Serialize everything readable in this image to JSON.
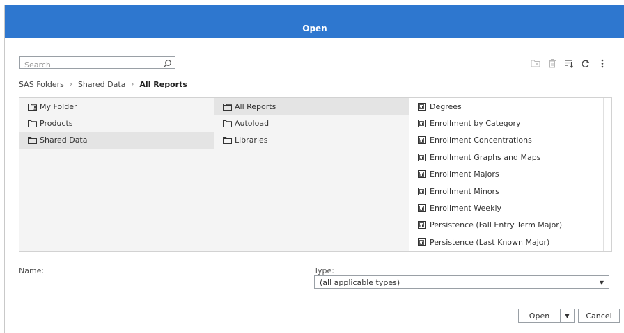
{
  "dialog": {
    "title": "Open"
  },
  "search": {
    "placeholder": "Search"
  },
  "toolbar": {
    "icons": [
      "new-folder-icon",
      "delete-icon",
      "sort-icon",
      "refresh-icon",
      "more-icon"
    ]
  },
  "breadcrumb": {
    "items": [
      "SAS Folders",
      "Shared Data"
    ],
    "current": "All Reports"
  },
  "columns": {
    "first": [
      {
        "label": "My Folder",
        "icon": "user-folder-icon"
      },
      {
        "label": "Products",
        "icon": "folder-icon"
      },
      {
        "label": "Shared Data",
        "icon": "folder-icon",
        "selected": true
      }
    ],
    "second": [
      {
        "label": "All Reports",
        "icon": "folder-icon",
        "selected": true
      },
      {
        "label": "Autoload",
        "icon": "folder-icon"
      },
      {
        "label": "Libraries",
        "icon": "folder-icon"
      }
    ],
    "third": [
      {
        "label": "Degrees",
        "icon": "report-icon"
      },
      {
        "label": "Enrollment by Category",
        "icon": "report-icon"
      },
      {
        "label": "Enrollment Concentrations",
        "icon": "report-icon"
      },
      {
        "label": "Enrollment Graphs and Maps",
        "icon": "report-icon"
      },
      {
        "label": "Enrollment Majors",
        "icon": "report-icon"
      },
      {
        "label": "Enrollment Minors",
        "icon": "report-icon"
      },
      {
        "label": "Enrollment Weekly",
        "icon": "report-icon"
      },
      {
        "label": "Persistence (Fall Entry Term Major)",
        "icon": "report-icon"
      },
      {
        "label": "Persistence (Last Known Major)",
        "icon": "report-icon"
      }
    ]
  },
  "form": {
    "name_label": "Name:",
    "type_label": "Type:",
    "type_value": "(all applicable types)"
  },
  "buttons": {
    "open": "Open",
    "cancel": "Cancel"
  },
  "colors": {
    "titlebar": "#2e77cf",
    "selected_row": "#e4e4e4",
    "column_bg": "#f4f4f4"
  }
}
